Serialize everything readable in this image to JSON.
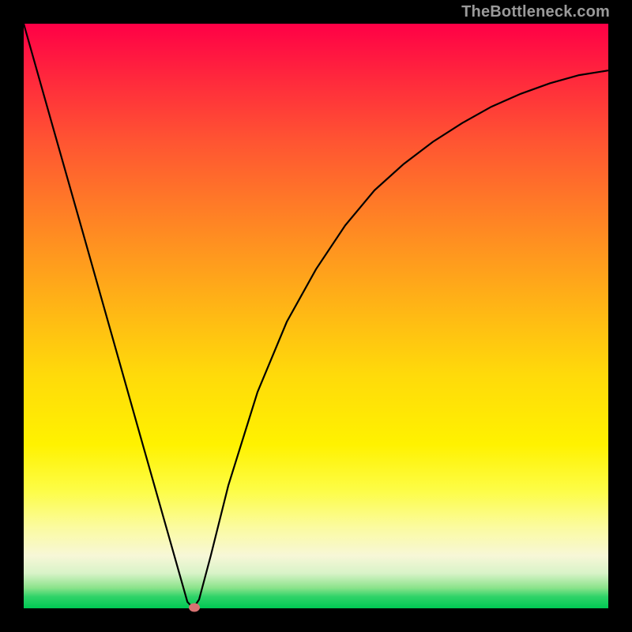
{
  "watermark": "TheBottleneck.com",
  "chart_data": {
    "type": "line",
    "title": "",
    "xlabel": "",
    "ylabel": "",
    "xlim": [
      0,
      1
    ],
    "ylim": [
      0,
      1
    ],
    "x": [
      0.0,
      0.05,
      0.1,
      0.15,
      0.2,
      0.25,
      0.28,
      0.29,
      0.3,
      0.32,
      0.35,
      0.4,
      0.45,
      0.5,
      0.55,
      0.6,
      0.65,
      0.7,
      0.75,
      0.8,
      0.85,
      0.9,
      0.95,
      1.0
    ],
    "y": [
      1.0,
      0.823,
      0.647,
      0.47,
      0.293,
      0.117,
      0.011,
      0.0,
      0.015,
      0.09,
      0.21,
      0.37,
      0.49,
      0.58,
      0.655,
      0.715,
      0.76,
      0.798,
      0.83,
      0.858,
      0.88,
      0.898,
      0.912,
      0.92
    ],
    "marker": {
      "x": 0.292,
      "y": 0.002
    },
    "background_gradient": {
      "stops": [
        {
          "pos": 0.0,
          "color": "#ff0046"
        },
        {
          "pos": 0.5,
          "color": "#ffba14"
        },
        {
          "pos": 0.72,
          "color": "#fff200"
        },
        {
          "pos": 0.91,
          "color": "#f7f7d7"
        },
        {
          "pos": 1.0,
          "color": "#00c853"
        }
      ]
    }
  }
}
